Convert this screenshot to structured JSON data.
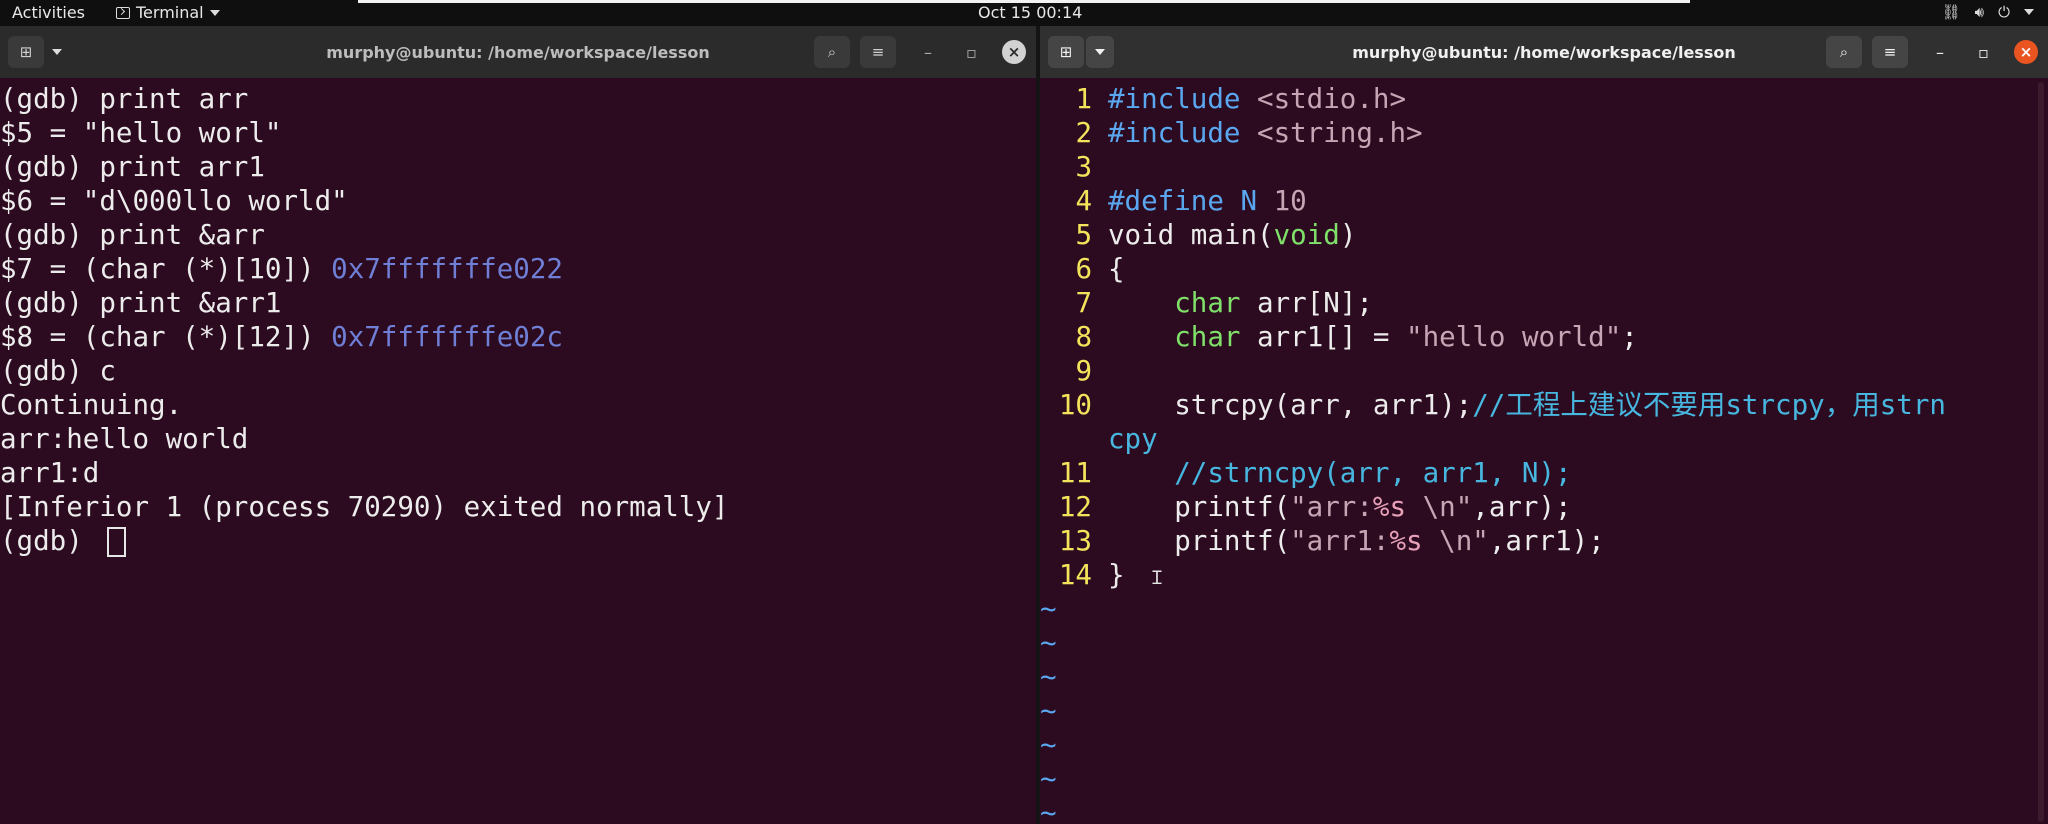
{
  "topbar": {
    "activities": "Activities",
    "app_menu": "Terminal",
    "clock": "Oct 15  00:14"
  },
  "left_window": {
    "title": "murphy@ubuntu: /home/workspace/lesson",
    "lines": [
      {
        "text": "(gdb) print arr",
        "addr": ""
      },
      {
        "text": "$5 = \"hello worl\"",
        "addr": ""
      },
      {
        "text": "(gdb) print arr1",
        "addr": ""
      },
      {
        "text": "$6 = \"d\\000llo world\"",
        "addr": ""
      },
      {
        "text": "(gdb) print &arr",
        "addr": ""
      },
      {
        "text": "$7 = (char (*)[10]) ",
        "addr": "0x7fffffffe022"
      },
      {
        "text": "(gdb) print &arr1",
        "addr": ""
      },
      {
        "text": "$8 = (char (*)[12]) ",
        "addr": "0x7fffffffe02c"
      },
      {
        "text": "(gdb) c",
        "addr": ""
      },
      {
        "text": "Continuing.",
        "addr": ""
      },
      {
        "text": "arr:hello world",
        "addr": ""
      },
      {
        "text": "arr1:d",
        "addr": ""
      },
      {
        "text": "[Inferior 1 (process 70290) exited normally]",
        "addr": ""
      }
    ],
    "prompt": "(gdb) "
  },
  "right_window": {
    "title": "murphy@ubuntu: /home/workspace/lesson",
    "code": {
      "l1": {
        "n": "1",
        "pre": "#include ",
        "str": "<stdio.h>"
      },
      "l2": {
        "n": "2",
        "pre": "#include ",
        "str": "<string.h>"
      },
      "l3": {
        "n": "3"
      },
      "l4": {
        "n": "4",
        "pre": "#define N ",
        "num": "10"
      },
      "l5": {
        "n": "5",
        "a": "void main(",
        "b": "void",
        "c": ")"
      },
      "l6": {
        "n": "6",
        "a": "{"
      },
      "l7": {
        "n": "7",
        "indent": "    ",
        "type": "char",
        "rest": " arr[N];"
      },
      "l8": {
        "n": "8",
        "indent": "    ",
        "type": "char",
        "rest": " arr1[] = ",
        "str": "\"hello world\"",
        "end": ";"
      },
      "l9": {
        "n": "9"
      },
      "l10": {
        "n": "10",
        "a": "    strcpy(arr, arr1);",
        "cmt": "//工程上建议不要用strcpy，用strn",
        "wrap": "cpy"
      },
      "l11": {
        "n": "11",
        "indent": "    ",
        "cmt": "//strncpy(arr, arr1, N);"
      },
      "l12": {
        "n": "12",
        "a": "    printf(",
        "s1": "\"arr:",
        "f1": "%s ",
        "s2": "\\n\"",
        "b": ",arr);"
      },
      "l13": {
        "n": "13",
        "a": "    printf(",
        "s1": "\"arr1:",
        "f1": "%s ",
        "s2": "\\n\"",
        "b": ",arr1);"
      },
      "l14": {
        "n": "14",
        "a": "}"
      }
    },
    "tilde": "~"
  }
}
